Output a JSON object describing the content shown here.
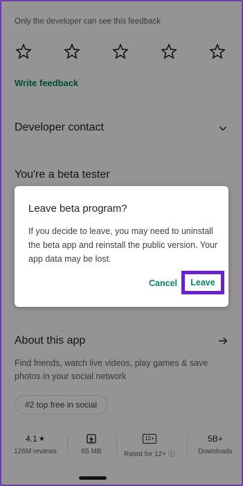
{
  "feedback": {
    "note": "Only the developer can see this feedback",
    "write_label": "Write feedback",
    "star_count": 5
  },
  "developer_contact": {
    "label": "Developer contact"
  },
  "beta": {
    "title": "You're a beta tester"
  },
  "about": {
    "title": "About this app",
    "description": "Find friends, watch live videos, play games & save photos in your social network",
    "chip": "#2 top free in social"
  },
  "stats": {
    "rating": {
      "value": "4.1",
      "sub": "126M reviews"
    },
    "size": {
      "value": "65 MB"
    },
    "content_rating": {
      "badge": "12+",
      "sub": "Rated for 12+"
    },
    "downloads": {
      "value": "5B+",
      "sub": "Downloads"
    }
  },
  "dialog": {
    "title": "Leave beta program?",
    "body": "If you decide to leave, you may need to uninstall the beta app and reinstall the public version. Your app data may be lost.",
    "cancel_label": "Cancel",
    "leave_label": "Leave"
  },
  "colors": {
    "accent": "#01875f",
    "highlight": "#6a1fd1",
    "scrim": "rgba(0,0,0,0.42)"
  }
}
